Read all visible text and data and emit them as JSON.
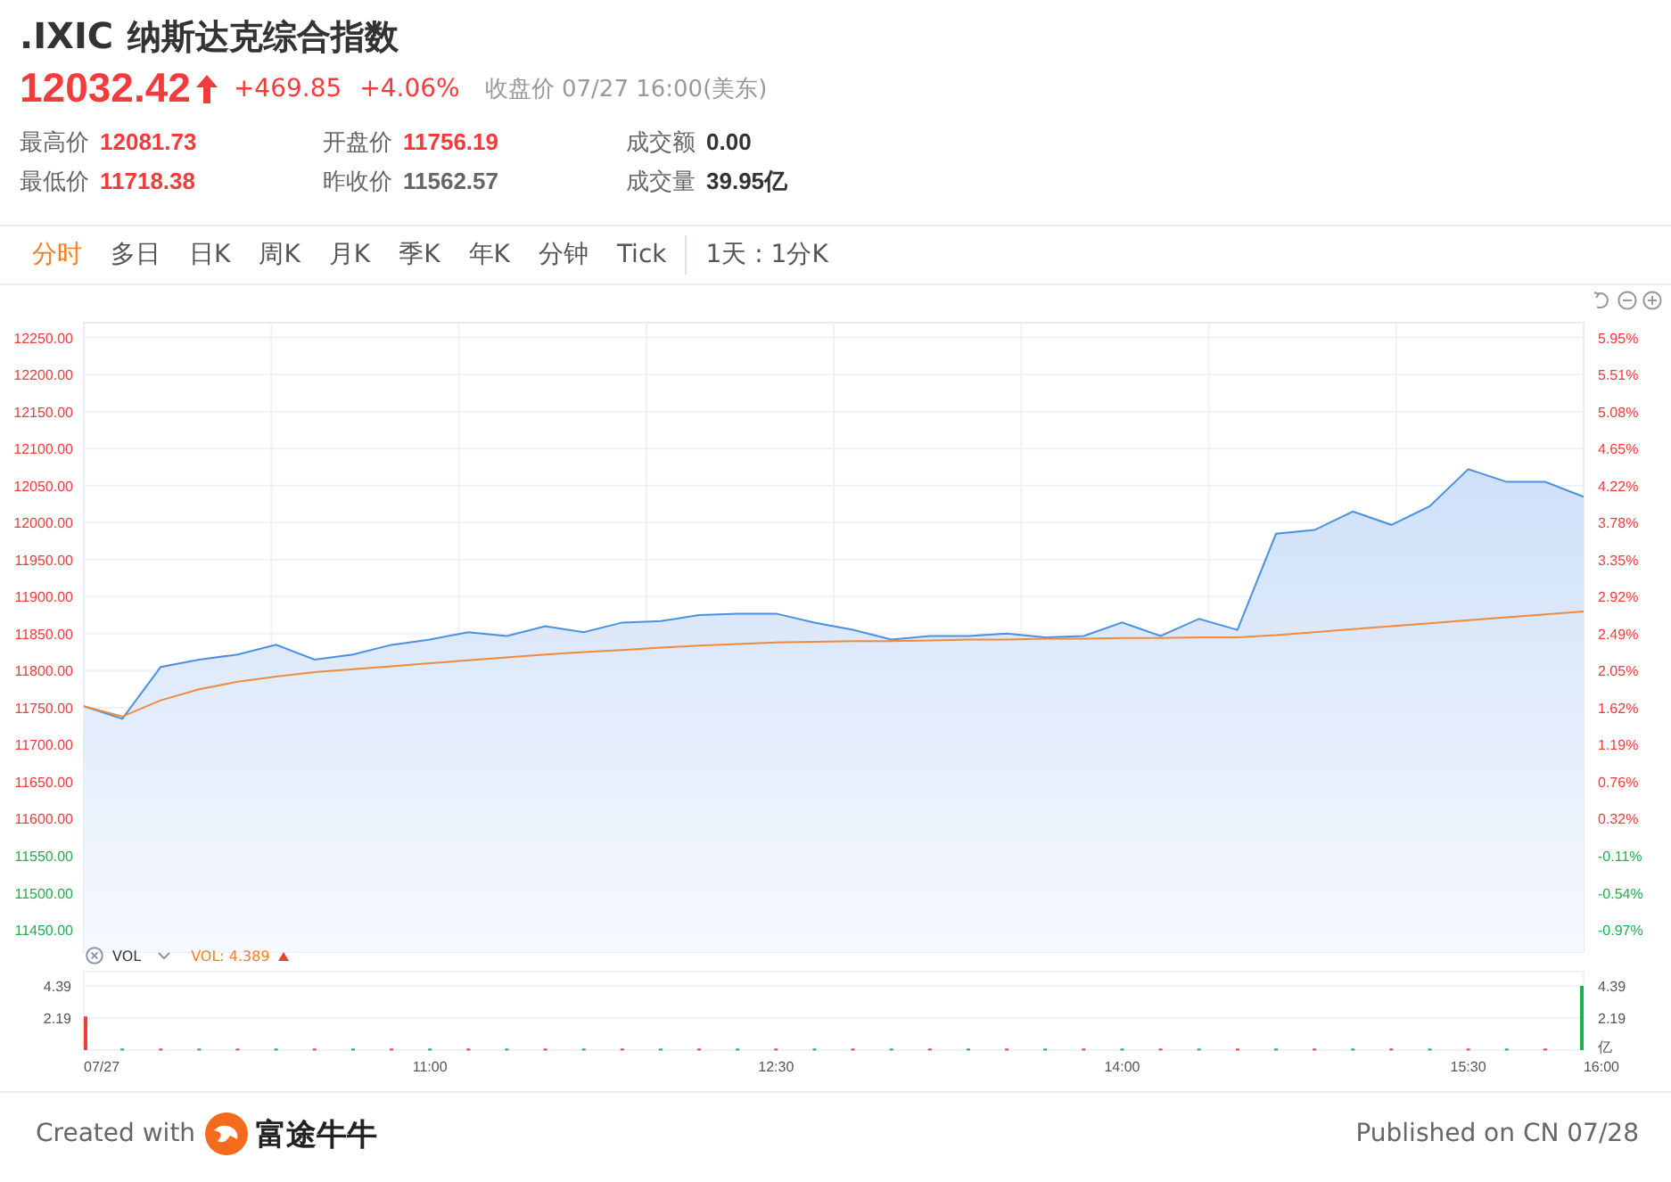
{
  "quote": {
    "symbol": ".IXIC",
    "name": "纳斯达克综合指数",
    "price": "12032.42",
    "rising": true,
    "change": "+469.85",
    "change_pct": "+4.06%",
    "status": "收盘价 07/27 16:00(美东)"
  },
  "stats": [
    {
      "label": "最高价",
      "value": "12081.73",
      "kind": "up"
    },
    {
      "label": "开盘价",
      "value": "11756.19",
      "kind": "up"
    },
    {
      "label": "成交额",
      "value": "0.00",
      "kind": "flat"
    },
    {
      "label": "最低价",
      "value": "11718.38",
      "kind": "up"
    },
    {
      "label": "昨收价",
      "value": "11562.57",
      "kind": "neutral"
    },
    {
      "label": "成交量",
      "value": "39.95亿",
      "kind": "flat"
    }
  ],
  "tabs": [
    {
      "label": "分时",
      "selected": true
    },
    {
      "label": "多日",
      "selected": false
    },
    {
      "label": "日K",
      "selected": false
    },
    {
      "label": "周K",
      "selected": false
    },
    {
      "label": "月K",
      "selected": false
    },
    {
      "label": "季K",
      "selected": false
    },
    {
      "label": "年K",
      "selected": false
    },
    {
      "label": "分钟",
      "selected": false
    },
    {
      "label": "Tick",
      "selected": false
    }
  ],
  "period": "1天 : 1分K",
  "price_chart": {
    "chart_data": {
      "type": "area",
      "grid": true,
      "categories": [
        null,
        null,
        null,
        null,
        null,
        null,
        null,
        null,
        null,
        null,
        null,
        null,
        null,
        null,
        null,
        null,
        null,
        null,
        null,
        null,
        null,
        null,
        null,
        null,
        null,
        null,
        null,
        null,
        null,
        null,
        null,
        null,
        null,
        null,
        null,
        null,
        null,
        null,
        null,
        null
      ],
      "series": [
        {
          "color": "#4a90e2",
          "values": [
            11752,
            11735,
            11805,
            11815,
            11822,
            11835,
            11815,
            11822,
            11835,
            11842,
            11852,
            11847,
            11860,
            11852,
            11865,
            11867,
            11875,
            11877,
            11877,
            11865,
            11855,
            11842,
            11847,
            11847,
            11850,
            11845,
            11847,
            11865,
            11847,
            11870,
            11855,
            11985,
            11990,
            12015,
            11997,
            12022,
            12072,
            12055,
            12055,
            12035
          ]
        },
        {
          "type": "line",
          "color": "#f08a3c",
          "values": [
            11752,
            11738,
            11760,
            11775,
            11785,
            11792,
            11798,
            11802,
            11806,
            11810,
            11814,
            11818,
            11822,
            11825,
            11828,
            11831,
            11834,
            11836,
            11838,
            11839,
            11840,
            11840,
            11841,
            11842,
            11842,
            11843,
            11843,
            11844,
            11844,
            11845,
            11845,
            11848,
            11852,
            11856,
            11860,
            11864,
            11868,
            11872,
            11876,
            11880
          ]
        }
      ],
      "ylim": [
        11420,
        12270
      ],
      "yticks": [
        {
          "value": 12250,
          "label": "12250.00"
        },
        {
          "value": 12200,
          "label": "12200.00"
        },
        {
          "value": 12150,
          "label": "12150.00"
        },
        {
          "value": 12100,
          "label": "12100.00"
        },
        {
          "value": 12050,
          "label": "12050.00"
        },
        {
          "value": 12000,
          "label": "12000.00"
        },
        {
          "value": 11950,
          "label": "11950.00"
        },
        {
          "value": 11900,
          "label": "11900.00"
        },
        {
          "value": 11850,
          "label": "11850.00"
        },
        {
          "value": 11800,
          "label": "11800.00"
        },
        {
          "value": 11750,
          "label": "11750.00"
        },
        {
          "value": 11700,
          "label": "11700.00"
        },
        {
          "value": 11650,
          "label": "11650.00"
        },
        {
          "value": 11600,
          "label": "11600.00"
        },
        {
          "value": 11550,
          "label": "11550.00"
        },
        {
          "value": 11500,
          "label": "11500.00"
        },
        {
          "value": 11450,
          "label": "11450.00"
        }
      ]
    },
    "right_axis": [
      {
        "label": "5.95%",
        "kind": "up"
      },
      {
        "label": "5.51%",
        "kind": "up"
      },
      {
        "label": "5.08%",
        "kind": "up"
      },
      {
        "label": "4.65%",
        "kind": "up"
      },
      {
        "label": "4.22%",
        "kind": "up"
      },
      {
        "label": "3.78%",
        "kind": "up"
      },
      {
        "label": "3.35%",
        "kind": "up"
      },
      {
        "label": "2.92%",
        "kind": "up"
      },
      {
        "label": "2.49%",
        "kind": "up"
      },
      {
        "label": "2.05%",
        "kind": "up"
      },
      {
        "label": "1.62%",
        "kind": "up"
      },
      {
        "label": "1.19%",
        "kind": "up"
      },
      {
        "label": "0.76%",
        "kind": "up"
      },
      {
        "label": "0.32%",
        "kind": "up"
      },
      {
        "label": "-0.11%",
        "kind": "down"
      },
      {
        "label": "-0.54%",
        "kind": "down"
      },
      {
        "label": "-0.97%",
        "kind": "down"
      }
    ]
  },
  "volume": {
    "indicator": "VOL",
    "reading": "VOL: 4.389",
    "rising": true,
    "chart_data": {
      "type": "bar",
      "categories": [
        "07/27",
        null,
        null,
        null,
        null,
        null,
        null,
        null,
        null,
        "11:00",
        null,
        null,
        null,
        null,
        null,
        null,
        null,
        null,
        "12:30",
        null,
        null,
        null,
        null,
        null,
        null,
        null,
        null,
        "14:00",
        null,
        null,
        null,
        null,
        null,
        null,
        null,
        null,
        "15:30",
        null,
        null,
        "16:00"
      ],
      "series": [
        {
          "color": "#f23c3c",
          "values": [
            2.3,
            null,
            0.1,
            null,
            0.1,
            null,
            0.1,
            null,
            0.1,
            null,
            0.1,
            null,
            0.1,
            null,
            0.1,
            null,
            0.1,
            null,
            0.1,
            null,
            0.1,
            null,
            0.1,
            null,
            0.1,
            null,
            0.1,
            null,
            0.1,
            null,
            0.1,
            null,
            0.1,
            null,
            0.1,
            null,
            0.1,
            null,
            0.1,
            null
          ]
        },
        {
          "color": "#20b04a",
          "values": [
            null,
            0.1,
            null,
            0.1,
            null,
            0.1,
            null,
            0.1,
            null,
            0.1,
            null,
            0.1,
            null,
            0.1,
            null,
            0.1,
            null,
            0.1,
            null,
            0.1,
            null,
            0.1,
            null,
            0.1,
            null,
            0.1,
            null,
            0.1,
            null,
            0.1,
            null,
            0.1,
            null,
            0.1,
            null,
            0.1,
            null,
            0.1,
            null,
            4.39
          ]
        }
      ],
      "ylim": [
        0,
        4.39
      ],
      "yticks": [
        {
          "value": 4.39,
          "label": "4.39"
        },
        {
          "value": 2.19,
          "label": "2.19"
        }
      ]
    },
    "unit": "亿"
  },
  "footer": {
    "created": "Created with",
    "brand": "富途牛牛",
    "published": "Published on CN 07/28"
  }
}
